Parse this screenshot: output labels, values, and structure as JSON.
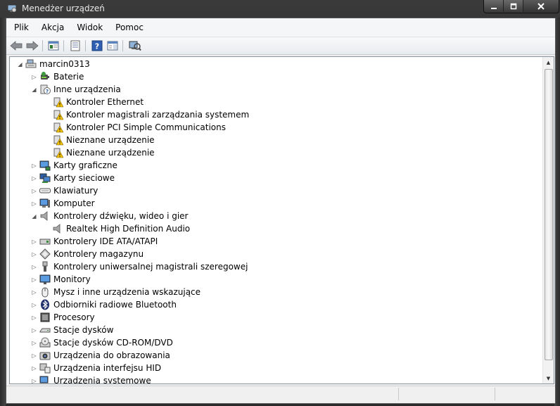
{
  "window": {
    "title": "Menedżer urządzeń"
  },
  "menu": [
    {
      "id": "file",
      "label": "Plik"
    },
    {
      "id": "action",
      "label": "Akcja"
    },
    {
      "id": "view",
      "label": "Widok"
    },
    {
      "id": "help",
      "label": "Pomoc"
    }
  ],
  "toolbar": {
    "icons": [
      "back-icon",
      "forward-icon",
      "console-tree-icon",
      "properties-icon",
      "help-icon",
      "show-hide-icon",
      "scan-hardware-icon"
    ]
  },
  "tree": {
    "root": "marcin0313",
    "rows": [
      {
        "label": "Baterie",
        "level": 1,
        "expander": "collapsed",
        "icon": "battery-icon"
      },
      {
        "label": "Inne urządzenia",
        "level": 1,
        "expander": "expanded",
        "icon": "other-devices-icon"
      },
      {
        "label": "Kontroler Ethernet",
        "level": 2,
        "expander": "none",
        "icon": "warning-device-icon"
      },
      {
        "label": "Kontroler magistrali zarządzania systemem",
        "level": 2,
        "expander": "none",
        "icon": "warning-device-icon"
      },
      {
        "label": "Kontroler PCI Simple Communications",
        "level": 2,
        "expander": "none",
        "icon": "warning-device-icon"
      },
      {
        "label": "Nieznane urządzenie",
        "level": 2,
        "expander": "none",
        "icon": "warning-device-icon"
      },
      {
        "label": "Nieznane urządzenie",
        "level": 2,
        "expander": "none",
        "icon": "warning-device-icon"
      },
      {
        "label": "Karty graficzne",
        "level": 1,
        "expander": "collapsed",
        "icon": "display-adapter-icon"
      },
      {
        "label": "Karty sieciowe",
        "level": 1,
        "expander": "collapsed",
        "icon": "network-adapter-icon"
      },
      {
        "label": "Klawiatury",
        "level": 1,
        "expander": "collapsed",
        "icon": "keyboard-icon"
      },
      {
        "label": "Komputer",
        "level": 1,
        "expander": "collapsed",
        "icon": "computer-icon"
      },
      {
        "label": "Kontrolery dźwięku, wideo i gier",
        "level": 1,
        "expander": "expanded",
        "icon": "speaker-icon"
      },
      {
        "label": "Realtek High Definition Audio",
        "level": 2,
        "expander": "none",
        "icon": "speaker-icon"
      },
      {
        "label": "Kontrolery IDE ATA/ATAPI",
        "level": 1,
        "expander": "collapsed",
        "icon": "ide-controller-icon"
      },
      {
        "label": "Kontrolery magazynu",
        "level": 1,
        "expander": "collapsed",
        "icon": "storage-controller-icon"
      },
      {
        "label": "Kontrolery uniwersalnej magistrali szeregowej",
        "level": 1,
        "expander": "collapsed",
        "icon": "usb-icon"
      },
      {
        "label": "Monitory",
        "level": 1,
        "expander": "collapsed",
        "icon": "monitor-icon"
      },
      {
        "label": "Mysz i inne urządzenia wskazujące",
        "level": 1,
        "expander": "collapsed",
        "icon": "mouse-icon"
      },
      {
        "label": "Odbiorniki radiowe Bluetooth",
        "level": 1,
        "expander": "collapsed",
        "icon": "bluetooth-icon"
      },
      {
        "label": "Procesory",
        "level": 1,
        "expander": "collapsed",
        "icon": "processor-icon"
      },
      {
        "label": "Stacje dysków",
        "level": 1,
        "expander": "collapsed",
        "icon": "disk-drive-icon"
      },
      {
        "label": "Stacje dysków CD-ROM/DVD",
        "level": 1,
        "expander": "collapsed",
        "icon": "dvd-drive-icon"
      },
      {
        "label": "Urządzenia do obrazowania",
        "level": 1,
        "expander": "collapsed",
        "icon": "camera-icon"
      },
      {
        "label": "Urządzenia interfejsu HID",
        "level": 1,
        "expander": "collapsed",
        "icon": "hid-icon"
      },
      {
        "label": "Urządzenia systemowe",
        "level": 1,
        "expander": "collapsed",
        "icon": "system-devices-icon"
      }
    ]
  }
}
